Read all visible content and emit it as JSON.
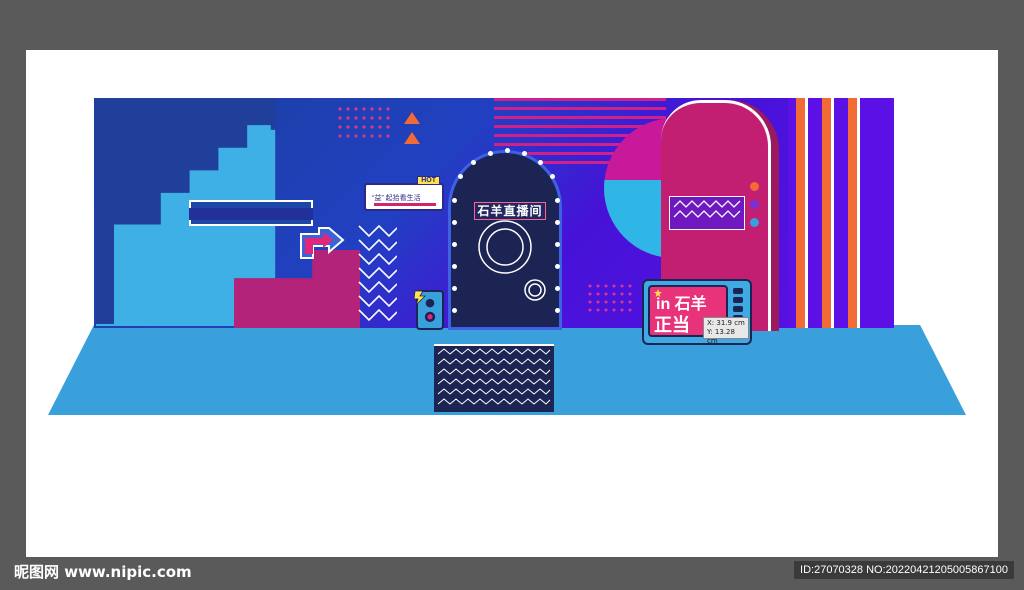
{
  "canvas": {
    "background_color": "#5a5a5a",
    "artboard_color": "#ffffff"
  },
  "scene": {
    "hot_sign": {
      "tag": "HOT",
      "text": "“益” 起拾看生活"
    },
    "door": {
      "sign_text": "石羊直播间"
    },
    "tv": {
      "line1": "in 石羊",
      "line2": "正当"
    },
    "colors": {
      "wall_blue": "#2140c2",
      "wall_purple": "#5b10e6",
      "sky_blue": "#3fb0e5",
      "magenta": "#c31f72",
      "orange_stripe": "#f26a35",
      "floor": "#3aa0dc"
    }
  },
  "coordinate_readout": {
    "x": "X: 31.9 cm",
    "y": "Y: 13.28 cm"
  },
  "footer": {
    "brand": "昵图网 www.nipic.com",
    "id_text": "ID:27070328 NO:20220421205005867100"
  }
}
